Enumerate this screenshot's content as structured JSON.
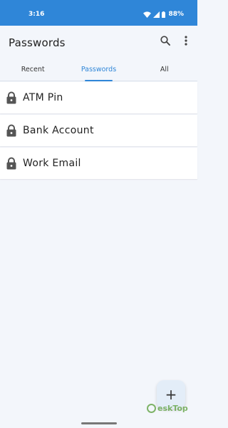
{
  "status_bar": {
    "time": "3:16",
    "battery_text": "88%",
    "icons": [
      "wifi-icon",
      "signal-icon",
      "battery-icon"
    ]
  },
  "app_bar": {
    "title": "Passwords",
    "actions": [
      "search-icon",
      "more-vert-icon"
    ]
  },
  "tabs": [
    {
      "label": "Recent",
      "active": false
    },
    {
      "label": "Passwords",
      "active": true
    },
    {
      "label": "All",
      "active": false
    }
  ],
  "passwords": [
    {
      "label": "ATM Pin",
      "icon": "lock-icon"
    },
    {
      "label": "Bank Account",
      "icon": "lock-icon"
    },
    {
      "label": "Work Email",
      "icon": "lock-icon"
    }
  ],
  "fab": {
    "label": "+"
  },
  "watermark": {
    "text": "eskTop"
  },
  "colors": {
    "accent": "#2f86d8",
    "background": "#f3f6fb"
  }
}
